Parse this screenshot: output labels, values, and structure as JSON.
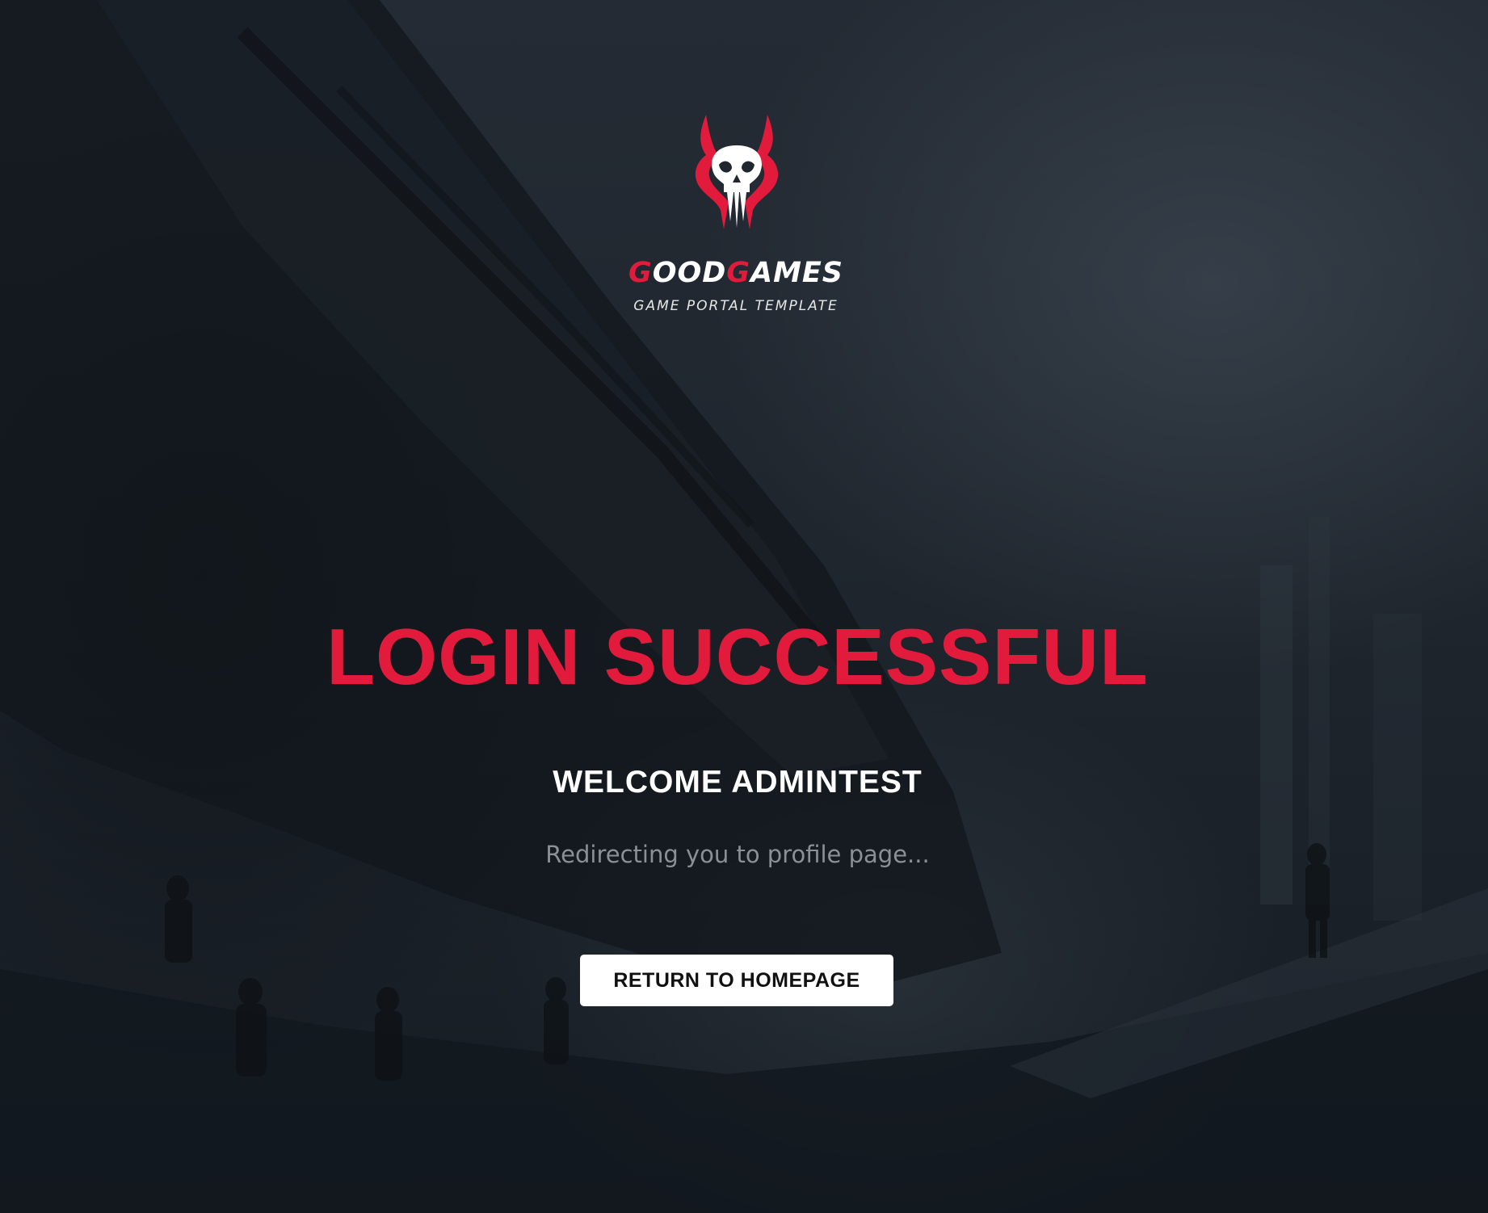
{
  "brand": {
    "name_first_initial": "G",
    "name_first_rest": "OOD",
    "name_second_initial": "G",
    "name_second_rest": "AMES",
    "tagline": "GAME PORTAL TEMPLATE",
    "logo_icon": "skull-logo-icon",
    "accent_color": "#e21b3c"
  },
  "main": {
    "headline": "LOGIN SUCCESSFUL",
    "welcome": "WELCOME ADMINTEST",
    "redirect_message": "Redirecting you to profile page...",
    "home_button_label": "RETURN TO HOMEPAGE"
  },
  "colors": {
    "accent": "#e21b3c",
    "background": "#1f262e",
    "button_bg": "#ffffff",
    "muted_text": "#8b9096"
  }
}
